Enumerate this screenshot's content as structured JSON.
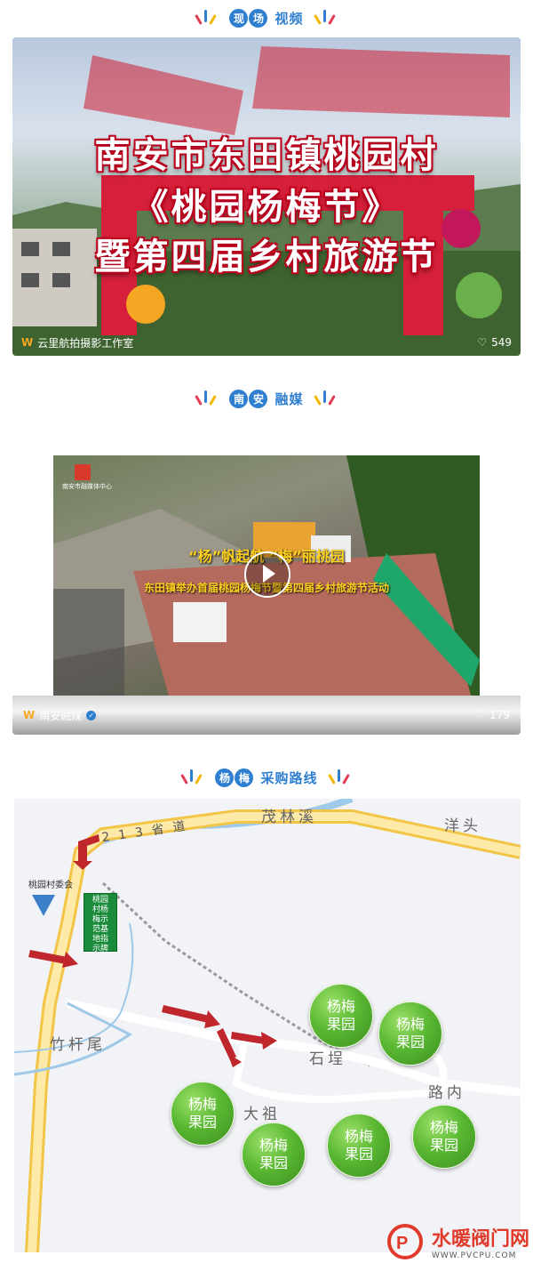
{
  "sections": [
    {
      "circles": [
        "现",
        "场"
      ],
      "text": "视频"
    },
    {
      "circles": [
        "南",
        "安"
      ],
      "text": "融媒"
    },
    {
      "circles": [
        "杨",
        "梅"
      ],
      "text": "采购路线"
    }
  ],
  "video1": {
    "lines": [
      "南安市东田镇桃园村",
      "《桃园杨梅节》",
      "暨第四届乡村旅游节"
    ],
    "channel": "云里航拍摄影工作室",
    "likes": "549"
  },
  "video2": {
    "logo_text": "南安市融媒体中心",
    "banner_title": "“杨”帆起航 “梅”丽桃园",
    "banner_subtitle": "东田镇举办首届桃园杨梅节暨第四届乡村旅游节活动",
    "channel": "南安融媒",
    "likes": "179"
  },
  "map": {
    "road_label": "213省道",
    "places": [
      "茂林溪",
      "洋头",
      "竹杆尾",
      "石埕",
      "路内",
      "大祖"
    ],
    "village_committee": "桃园村委会",
    "signboard": "桃园村杨梅示范基地指示牌",
    "orchard_label": "杨梅果园",
    "colors": {
      "orchard": "#5ab833",
      "road": "#f4c542",
      "arrow": "#c0272d"
    }
  },
  "watermark": {
    "name": "水暖阀门网",
    "url": "WWW.PVCPU.COM"
  }
}
